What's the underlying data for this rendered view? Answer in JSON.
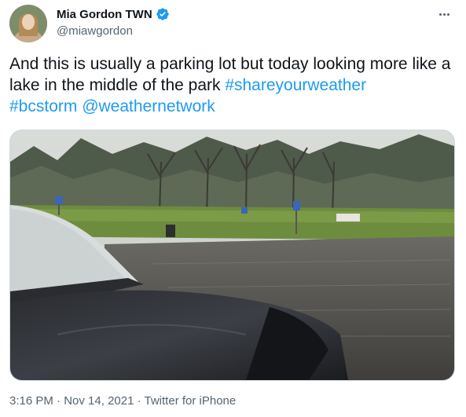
{
  "author": {
    "display_name": "Mia Gordon TWN",
    "handle": "@miawgordon",
    "verified": true
  },
  "tweet": {
    "text_plain": "And this is usually a parking lot but today looking more like a lake in the middle of the park ",
    "hashtag_1": "#shareyourweather",
    "hashtag_2": "#bcstorm",
    "mention": "@weathernetwork",
    "space": " "
  },
  "media": {
    "kind": "video-thumbnail",
    "icon": "flooded-parking-lot-photo"
  },
  "meta": {
    "time": "3:16 PM",
    "separator_1": " · ",
    "date": "Nov 14, 2021",
    "separator_2": " · ",
    "source": "Twitter for iPhone"
  },
  "colors": {
    "link": "#1d9bf0",
    "verified": "#1d9bf0",
    "secondary_text": "#536471"
  }
}
